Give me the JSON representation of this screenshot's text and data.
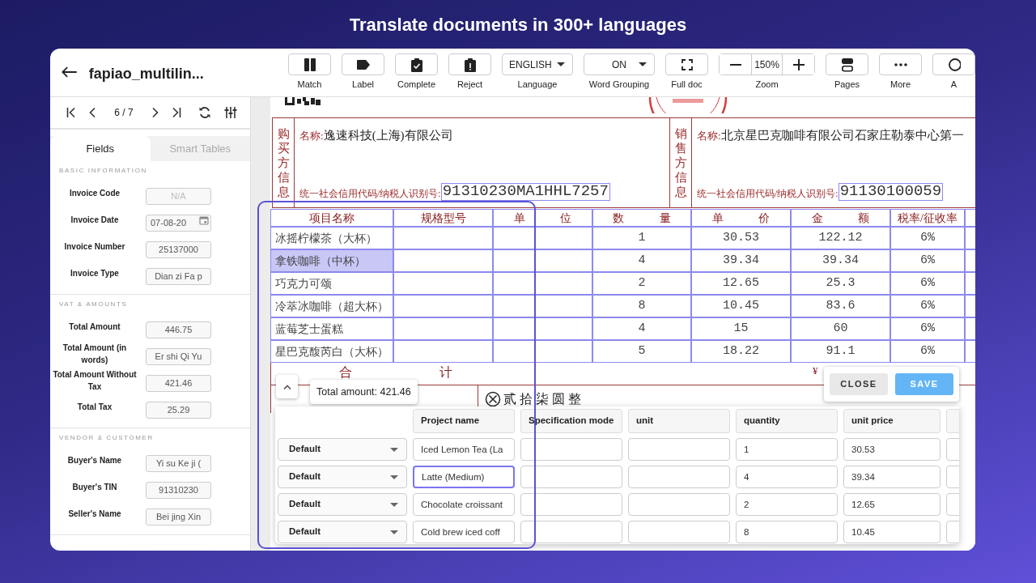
{
  "banner": {
    "title": "Translate documents in 300+ languages"
  },
  "header": {
    "title": "fapiao_multilin..."
  },
  "toolbar": [
    {
      "kind": "button",
      "label": "Match"
    },
    {
      "kind": "button",
      "label": "Label"
    },
    {
      "kind": "button",
      "label": "Complete"
    },
    {
      "kind": "button",
      "label": "Reject"
    },
    {
      "kind": "select",
      "value": "ENGLISH",
      "label": "Language"
    },
    {
      "kind": "select",
      "value": "ON",
      "label": "Word Grouping"
    },
    {
      "kind": "button",
      "label": "Full doc"
    },
    {
      "kind": "zoom",
      "value": "150%",
      "label": "Zoom"
    },
    {
      "kind": "button",
      "label": "Pages"
    },
    {
      "kind": "button",
      "label": "More"
    },
    {
      "kind": "button",
      "label": "A"
    }
  ],
  "pager": {
    "page": "6 / 7"
  },
  "side_tabs": [
    {
      "label": "Fields",
      "selected": true
    },
    {
      "label": "Smart Tables",
      "selected": false
    }
  ],
  "sections": [
    {
      "heading": "BASIC INFORMATION",
      "fields": [
        {
          "label": "Invoice Code",
          "kind": "text",
          "placeholder": "N/A"
        },
        {
          "label": "Invoice Date",
          "kind": "date",
          "value": "07-08-20"
        },
        {
          "label": "Invoice Number",
          "kind": "text",
          "value": "25137000"
        },
        {
          "label": "Invoice Type",
          "kind": "text",
          "value": "Dian zi Fa p"
        }
      ]
    },
    {
      "heading": "VAT & AMOUNTS",
      "fields": [
        {
          "label": "Total Amount",
          "kind": "text",
          "value": "446.75"
        },
        {
          "label": "Total Amount (in words)",
          "kind": "text",
          "value": "Er shi Qi Yu"
        },
        {
          "label": "Total Amount Without Tax",
          "kind": "text",
          "value": "421.46"
        },
        {
          "label": "Total Tax",
          "kind": "text",
          "value": "25.29"
        }
      ]
    },
    {
      "heading": "VENDOR & CUSTOMER",
      "fields": [
        {
          "label": "Buyer's Name",
          "kind": "text",
          "value": "Yi su Ke ji ("
        },
        {
          "label": "Buyer's TIN",
          "kind": "text",
          "value": "91310230"
        },
        {
          "label": "Seller's Name",
          "kind": "text",
          "value": "Bei jing Xin"
        }
      ]
    }
  ],
  "invoice": {
    "parties": [
      {
        "heading": "购买方信息",
        "name_label": "名称:",
        "name": "逸速科技(上海)有限公司",
        "tin_label": "统一社会信用代码/纳税人识别号:",
        "tin": "91310230MA1HHL7257"
      },
      {
        "heading": "销售方信息",
        "name_label": "名称:",
        "name": "北京星巴克咖啡有限公司石家庄勒泰中心第一",
        "tin_label": "统一社会信用代码/纳税人识别号:",
        "tin": "91130100059"
      }
    ],
    "columns": [
      "项目名称",
      "规格型号",
      "单 位",
      "数 量",
      "单 价",
      "金 额",
      "税率/征收率"
    ],
    "rows": [
      {
        "name": "冰摇柠檬茶（大杯）",
        "quantity": "1",
        "unit_price": "30.53",
        "amount": "122.12",
        "tax_rate": "6%",
        "selected": false
      },
      {
        "name": "拿铁咖啡（中杯）",
        "quantity": "4",
        "unit_price": "39.34",
        "amount": "39.34",
        "tax_rate": "6%",
        "selected": true
      },
      {
        "name": "巧克力可颂",
        "quantity": "2",
        "unit_price": "12.65",
        "amount": "25.3",
        "tax_rate": "6%",
        "selected": false
      },
      {
        "name": "冷萃冰咖啡（超大杯）",
        "quantity": "8",
        "unit_price": "10.45",
        "amount": "83.6",
        "tax_rate": "6%",
        "selected": false
      },
      {
        "name": "蓝莓芝士蛋糕",
        "quantity": "4",
        "unit_price": "15",
        "amount": "60",
        "tax_rate": "6%",
        "selected": false
      },
      {
        "name": "星巴克馥芮白（大杯）",
        "quantity": "5",
        "unit_price": "18.22",
        "amount": "91.1",
        "tax_rate": "6%",
        "selected": false
      }
    ],
    "total_label": [
      "合",
      "计"
    ],
    "currency": "¥",
    "amount_words": "贰拾柒圆整"
  },
  "tooltip": "Total amount: 421.46",
  "actions": [
    {
      "label": "CLOSE",
      "kind": "secondary"
    },
    {
      "label": "SAVE",
      "kind": "primary"
    }
  ],
  "grid": {
    "columns": [
      "Project name",
      "Specification mode",
      "unit",
      "quantity",
      "unit price"
    ],
    "rows": [
      {
        "type": "Default",
        "project_name": "Iced Lemon Tea (La",
        "quantity": "1",
        "unit_price": "30.53",
        "focused": false
      },
      {
        "type": "Default",
        "project_name": "Latte (Medium)",
        "quantity": "4",
        "unit_price": "39.34",
        "focused": true
      },
      {
        "type": "Default",
        "project_name": "Chocolate croissant",
        "quantity": "2",
        "unit_price": "12.65",
        "focused": false
      },
      {
        "type": "Default",
        "project_name": "Cold brew iced coff",
        "quantity": "8",
        "unit_price": "10.45",
        "focused": false
      }
    ]
  }
}
